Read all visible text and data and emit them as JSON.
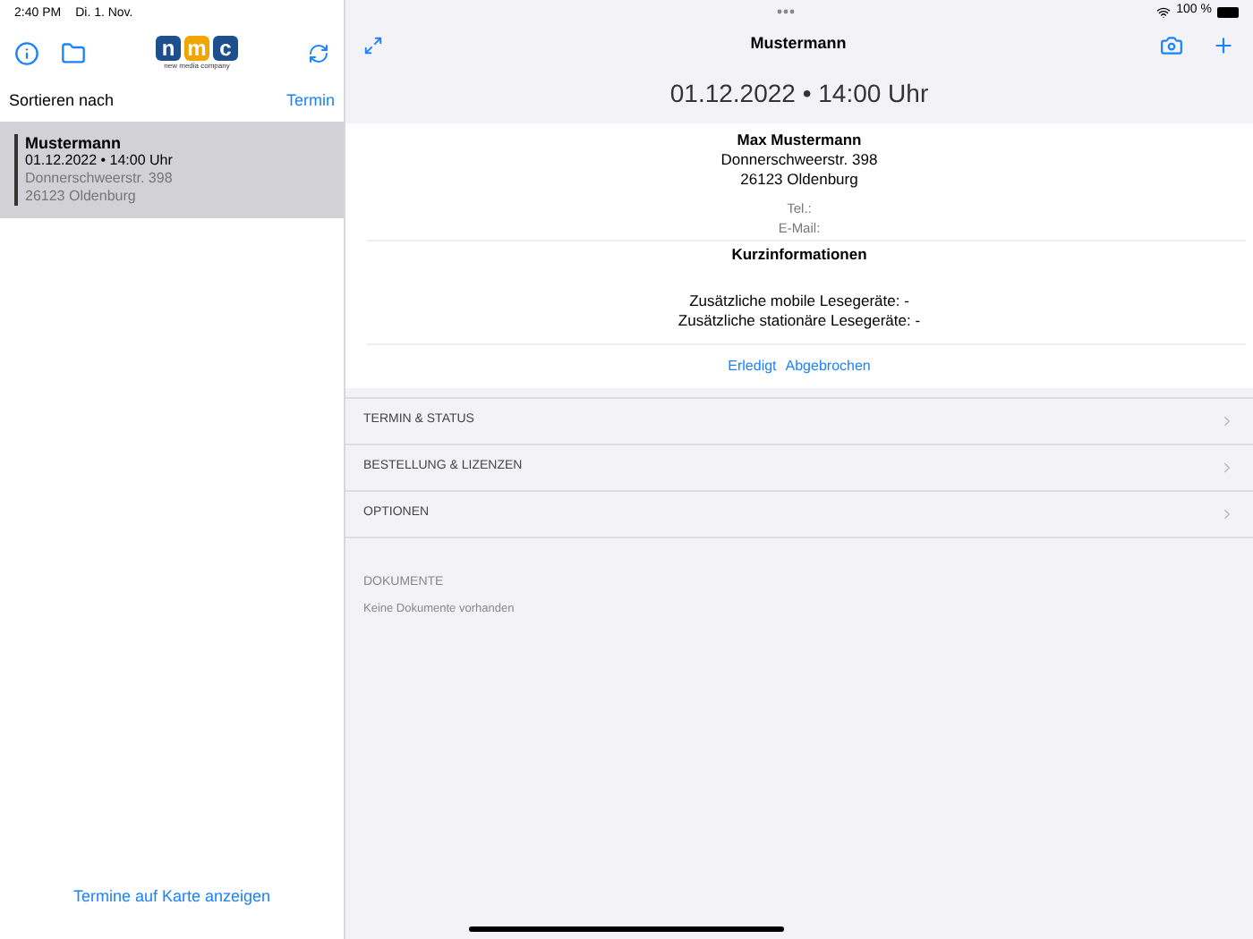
{
  "status_bar": {
    "time": "2:40 PM",
    "date": "Di. 1. Nov.",
    "battery": "100 %"
  },
  "sidebar": {
    "logo": {
      "letters": [
        "n",
        "m",
        "c"
      ],
      "tagline": "new media company"
    },
    "sort_label": "Sortieren nach",
    "sort_value": "Termin",
    "items": [
      {
        "name": "Mustermann",
        "datetime": "01.12.2022 • 14:00 Uhr",
        "street": "Donnerschweerstr. 398",
        "city": "26123 Oldenburg",
        "selected": true
      }
    ],
    "map_link": "Termine auf Karte anzeigen"
  },
  "detail": {
    "title": "Mustermann",
    "datetime": "01.12.2022 • 14:00 Uhr",
    "contact": {
      "name": "Max Mustermann",
      "street": "Donnerschweerstr. 398",
      "city": "26123 Oldenburg",
      "phone": "Tel.:",
      "email": "E-Mail:"
    },
    "info": {
      "heading": "Kurzinformationen",
      "lines": [
        "Zusätzliche mobile Lesegeräte: -",
        "Zusätzliche stationäre Lesegeräte: -"
      ]
    },
    "actions": [
      "Erledigt",
      "Abgebrochen"
    ],
    "sections": [
      "TERMIN & STATUS",
      "BESTELLUNG & LIZENZEN",
      "OPTIONEN"
    ],
    "documents": {
      "heading": "DOKUMENTE",
      "empty": "Keine Dokumente vorhanden"
    }
  }
}
